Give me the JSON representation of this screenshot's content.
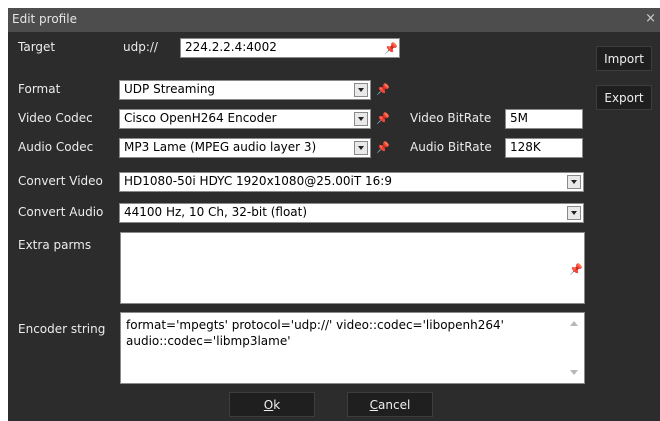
{
  "window": {
    "title": "Edit profile",
    "close_glyph": "×"
  },
  "target": {
    "label": "Target",
    "prefix": "udp://",
    "value": "224.2.2.4:4002"
  },
  "format": {
    "label": "Format",
    "value": "UDP Streaming"
  },
  "video_codec": {
    "label": "Video Codec",
    "value": "Cisco OpenH264 Encoder",
    "bitrate_label": "Video BitRate",
    "bitrate_value": "5M"
  },
  "audio_codec": {
    "label": "Audio Codec",
    "value": "MP3 Lame (MPEG audio layer 3)",
    "bitrate_label": "Audio BitRate",
    "bitrate_value": "128K"
  },
  "convert_video": {
    "label": "Convert Video",
    "value": "HD1080-50i HDYC 1920x1080@25.00iT 16:9"
  },
  "convert_audio": {
    "label": "Convert Audio",
    "value": "44100 Hz, 10 Ch, 32-bit (float)"
  },
  "extra_parms": {
    "label": "Extra parms",
    "value": ""
  },
  "encoder_string": {
    "label": "Encoder string",
    "line1": "format='mpegts' protocol='udp://' video::codec='libopenh264'",
    "line2": "audio::codec='libmp3lame'"
  },
  "buttons": {
    "import": "Import",
    "export": "Export",
    "ok_letter": "O",
    "ok_rest": "k",
    "cancel_letter": "C",
    "cancel_rest": "ancel"
  },
  "icons": {
    "pin": "pin-icon",
    "dropdown": "chevron-down-icon",
    "close": "close-icon"
  }
}
